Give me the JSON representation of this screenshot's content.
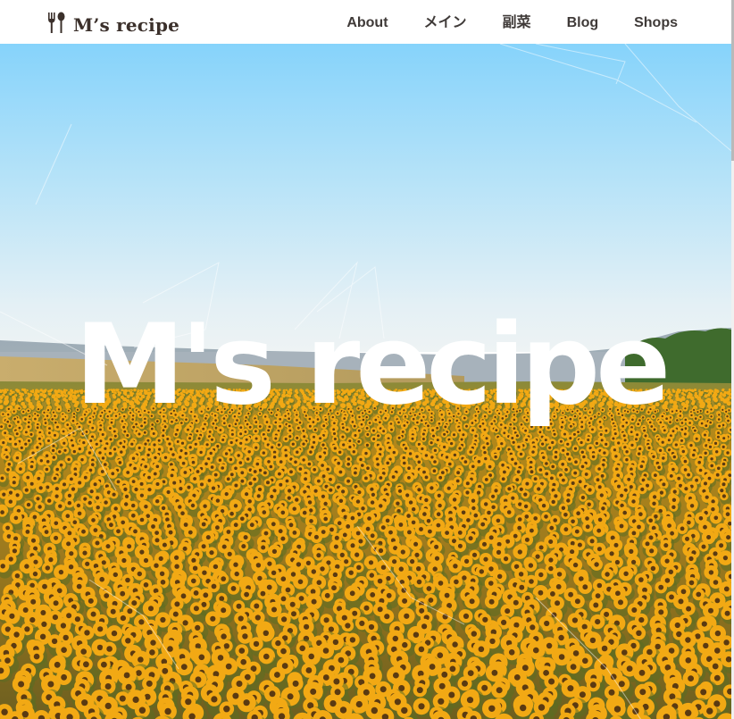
{
  "header": {
    "logo": {
      "text": "M’s recipe",
      "icon": "fork-spoon-icon"
    },
    "nav": [
      {
        "label": "About"
      },
      {
        "label": "メイン"
      },
      {
        "label": "副菜"
      },
      {
        "label": "Blog"
      },
      {
        "label": "Shops"
      }
    ]
  },
  "hero": {
    "title": "M's recipe",
    "image": "sunflower-field-image"
  },
  "colors": {
    "header_bg": "#ffffff",
    "nav_text": "#3f3a38",
    "logo_text": "#3b302b",
    "sky_top": "#8fd8fb",
    "sky_horizon": "#eef4f6",
    "sunflower": "#f2a914",
    "foliage": "#5b6d22",
    "hero_title": "#ffffff"
  }
}
